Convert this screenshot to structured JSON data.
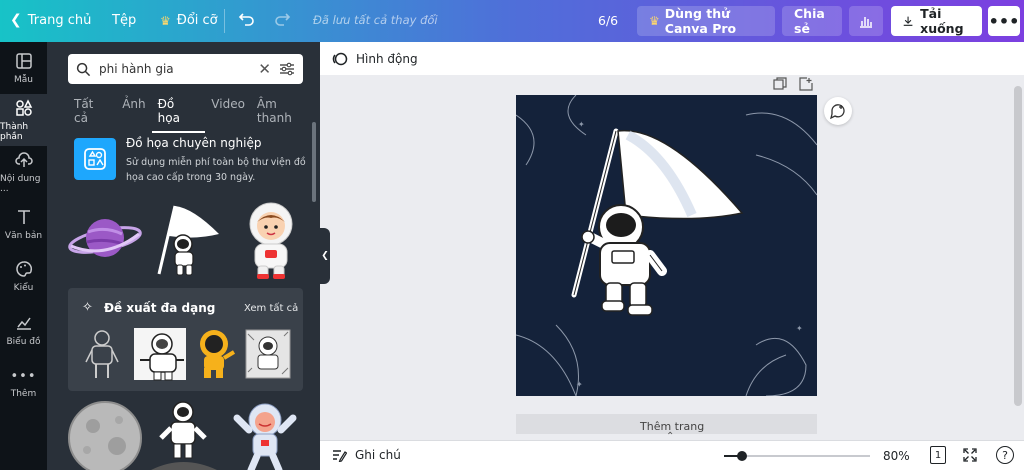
{
  "topbar": {
    "home": "Trang chủ",
    "file": "Tệp",
    "resize": "Đổi cỡ",
    "saved_status": "Đã lưu tất cả thay đổi",
    "page_counter": "6/6",
    "try_pro": "Dùng thử Canva Pro",
    "share": "Chia sẻ",
    "download": "Tải xuống"
  },
  "rail": {
    "items": [
      {
        "label": "Mẫu",
        "icon": "template-icon"
      },
      {
        "label": "Thành phần",
        "icon": "elements-icon"
      },
      {
        "label": "Nội dung ...",
        "icon": "upload-icon"
      },
      {
        "label": "Văn bản",
        "icon": "text-icon"
      },
      {
        "label": "Kiểu",
        "icon": "palette-icon"
      },
      {
        "label": "Biểu đồ",
        "icon": "chart-icon"
      },
      {
        "label": "Thêm",
        "icon": "more-icon"
      }
    ]
  },
  "panel": {
    "search_value": "phi hành gia",
    "tabs": [
      "Tất cả",
      "Ảnh",
      "Đồ họa",
      "Video",
      "Âm thanh"
    ],
    "active_tab": "Đồ họa",
    "pro_title": "Đồ họa chuyên nghiệp",
    "pro_desc": "Sử dụng miễn phí toàn bộ thư viện đồ họa cao cấp trong 30 ngày.",
    "suggest_title": "Đề xuất đa dạng",
    "see_all": "Xem tất cả"
  },
  "subbar": {
    "animate": "Hình động"
  },
  "canvas": {
    "next_page_label": "Thêm trang"
  },
  "bottombar": {
    "notes": "Ghi chú",
    "zoom": "80%",
    "zoom_level": 0.8,
    "page_num": "1",
    "help": "?"
  },
  "colors": {
    "canvas_bg": "#14223a",
    "panel_bg": "#293039",
    "rail_bg": "#0e1318",
    "pro_blue": "#1ea7fd"
  }
}
